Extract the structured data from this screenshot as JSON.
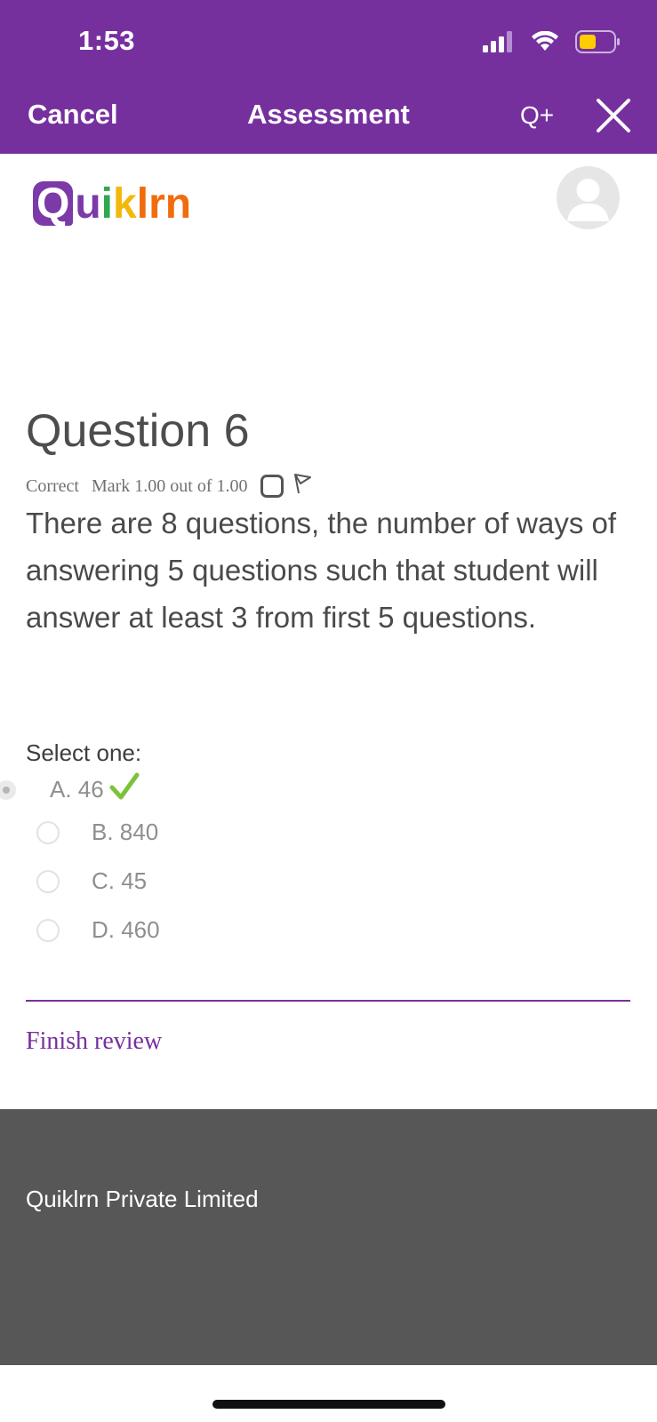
{
  "status_bar": {
    "time": "1:53",
    "icons": [
      "signal-icon",
      "wifi-icon",
      "battery-icon"
    ],
    "battery_color": "#ffcc00"
  },
  "nav": {
    "cancel_label": "Cancel",
    "title": "Assessment",
    "qplus_label": "Q+",
    "close_icon": "close-icon",
    "background": "#76309e"
  },
  "brand": {
    "logo_letters": [
      "Q",
      "u",
      "i",
      "k",
      "l",
      "r",
      "n"
    ],
    "logo_colors": [
      "#ffffff",
      "#7b3aa8",
      "#2fa84f",
      "#f2b90c",
      "#f26b0c",
      "#f26b0c",
      "#f26b0c"
    ],
    "avatar_icon": "user-avatar-icon"
  },
  "question": {
    "title": "Question 6",
    "state": "Correct",
    "mark": "Mark 1.00 out of 1.00",
    "text": "There are 8 questions, the number of ways of answering 5 questions such that student will answer at least 3 from first 5 questions.",
    "select_prompt": "Select one:",
    "options": [
      {
        "label": "A. 46",
        "selected": true,
        "correct": true
      },
      {
        "label": "B. 840",
        "selected": false
      },
      {
        "label": "C. 45",
        "selected": false
      },
      {
        "label": "D. 460",
        "selected": false
      }
    ],
    "accent_color": "#76309e",
    "correct_color": "#7cc23a"
  },
  "actions": {
    "finish_review_label": "Finish review"
  },
  "footer": {
    "company": "Quiklrn Private Limited",
    "background": "#575757"
  }
}
